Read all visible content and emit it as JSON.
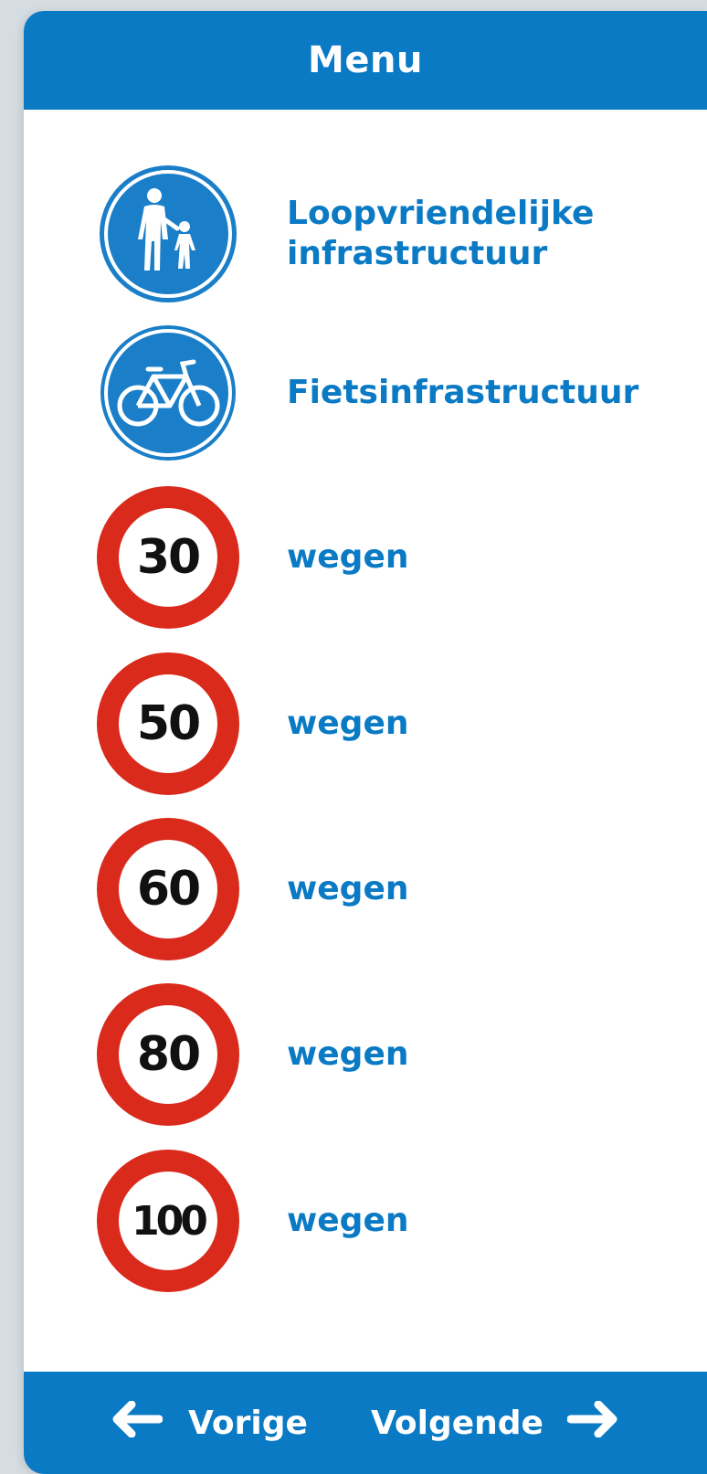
{
  "header": {
    "title": "Menu"
  },
  "menu": {
    "items": [
      {
        "label": "Loopvriendelijke infrastructuur",
        "icon": "pedestrian-sign-icon"
      },
      {
        "label": "Fietsinfrastructuur",
        "icon": "bicycle-sign-icon"
      },
      {
        "label": "wegen",
        "speed": "30",
        "icon": "speed-limit-sign-icon"
      },
      {
        "label": "wegen",
        "speed": "50",
        "icon": "speed-limit-sign-icon"
      },
      {
        "label": "wegen",
        "speed": "60",
        "icon": "speed-limit-sign-icon"
      },
      {
        "label": "wegen",
        "speed": "80",
        "icon": "speed-limit-sign-icon"
      },
      {
        "label": "wegen",
        "speed": "100",
        "icon": "speed-limit-sign-icon"
      }
    ]
  },
  "footer": {
    "prev_label": "Vorige",
    "next_label": "Volgende"
  },
  "colors": {
    "brand_blue": "#0a7ac4",
    "sign_red": "#d92a1c",
    "sign_blue": "#1a7fc8"
  }
}
